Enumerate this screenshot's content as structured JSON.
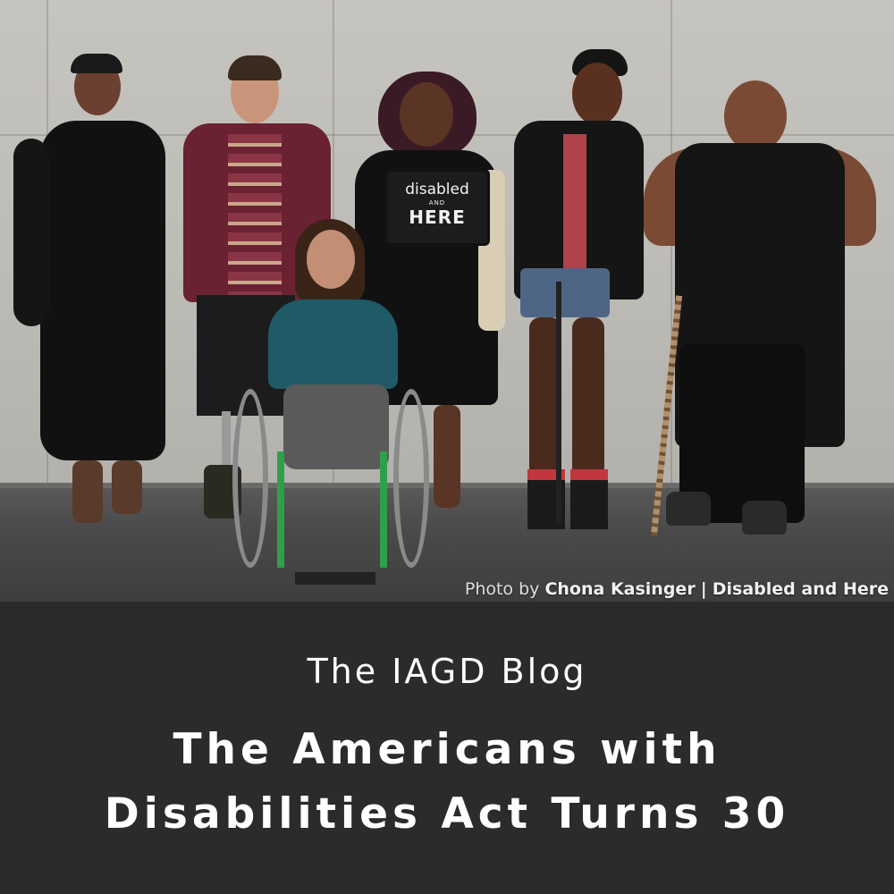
{
  "photo": {
    "sign": {
      "line1": "disabled",
      "line2": "AND",
      "line3": "HERE"
    },
    "credit": {
      "prefix": "Photo by",
      "photographer": "Chona Kasinger",
      "separator": "|",
      "project": "Disabled and Here"
    }
  },
  "panel": {
    "blog_name": "The IAGD Blog",
    "headline_line1": "The Americans with",
    "headline_line2": "Disabilities Act Turns 30"
  },
  "colors": {
    "panel_background": "#2b2b2b",
    "text": "#ffffff",
    "wall": "#c0beb9",
    "ground": "#4a4a4a"
  }
}
